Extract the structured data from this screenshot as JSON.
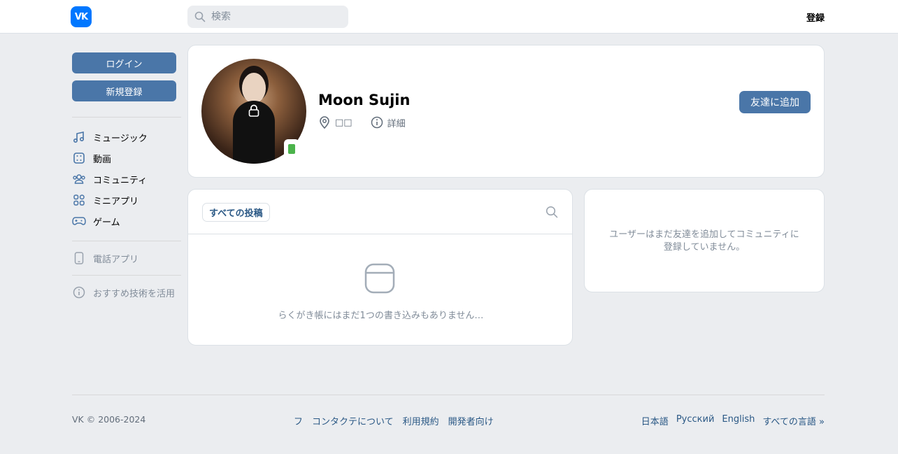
{
  "header": {
    "logo_text": "VK",
    "search_placeholder": "検索",
    "register_label": "登録"
  },
  "sidebar": {
    "login_label": "ログイン",
    "signup_label": "新規登録",
    "items": [
      {
        "label": "ミュージック",
        "icon": "music-icon"
      },
      {
        "label": "動画",
        "icon": "video-icon"
      },
      {
        "label": "コミュニティ",
        "icon": "community-icon"
      },
      {
        "label": "ミニアプリ",
        "icon": "mini-apps-icon"
      },
      {
        "label": "ゲーム",
        "icon": "games-icon"
      }
    ],
    "phone_app_label": "電話アプリ",
    "recommend_label": "おすすめ技術を活用"
  },
  "profile": {
    "name": "Moon Sujin",
    "location": "□□",
    "details_label": "詳細",
    "add_friend_label": "友達に追加"
  },
  "wall": {
    "tab_label": "すべての投稿",
    "empty_text": "らくがき帳にはまだ1つの書き込みもありません…"
  },
  "friends": {
    "empty_text": "ユーザーはまだ友達を追加してコミュニティに登録していません。"
  },
  "footer": {
    "copyright": "VK © 2006-2024",
    "links": [
      "フ",
      "コンタクテについて",
      "利用規約",
      "開発者向け"
    ],
    "languages": [
      "日本語",
      "Русский",
      "English",
      "すべての言語 »"
    ]
  },
  "colors": {
    "accent": "#4a76a8",
    "logo_blue": "#0077ff",
    "background": "#ebedf0",
    "link": "#2a5885",
    "online_green": "#4bb34b"
  }
}
